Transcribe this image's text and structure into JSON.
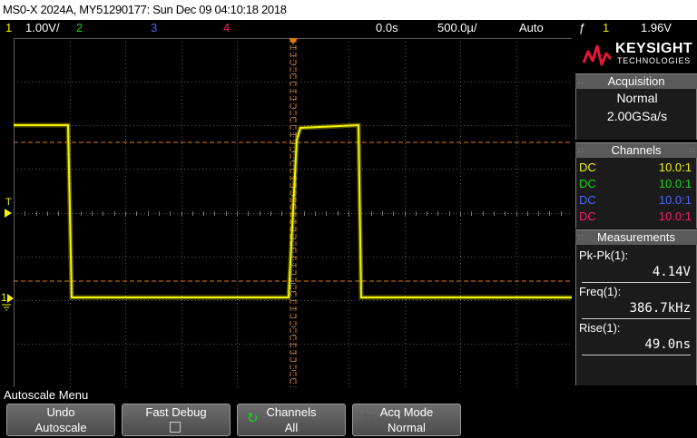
{
  "title_bar": {
    "text": "MS0-X 2024A, MY51290177: Sun Dec 09 04:10:18 2018"
  },
  "status_bar": {
    "ch1_num": "1",
    "ch1_scale": "1.00V/",
    "ch2_num": "2",
    "ch3_num": "3",
    "ch4_num": "4",
    "time_delay": "0.0s",
    "time_scale": "500.0µ/",
    "trigger_mode": "Auto",
    "trigger_slope_icon": "ƒ",
    "trigger_source": "1",
    "trigger_level": "1.96V"
  },
  "colors": {
    "ch1": "#f2f200",
    "ch2": "#19d219",
    "ch3": "#4a66ff",
    "ch4": "#ff1a6e",
    "cursor": "#e07a16",
    "grid": "#5a5a5a",
    "panel_header": "#5a5a5a"
  },
  "screen": {
    "trigger_marker": "T",
    "ground_marker": "1"
  },
  "panel": {
    "brand": "KEYSIGHT",
    "brand_sub": "TECHNOLOGIES",
    "acquisition": {
      "header": "Acquisition",
      "mode": "Normal",
      "rate": "2.00GSa/s"
    },
    "channels": {
      "header": "Channels",
      "rows": [
        {
          "coupling": "DC",
          "probe": "10.0:1"
        },
        {
          "coupling": "DC",
          "probe": "10.0:1"
        },
        {
          "coupling": "DC",
          "probe": "10.0:1"
        },
        {
          "coupling": "DC",
          "probe": "10.0:1"
        }
      ]
    },
    "measurements": {
      "header": "Measurements",
      "items": [
        {
          "label": "Pk-Pk(1):",
          "value": "4.14V"
        },
        {
          "label": "Freq(1):",
          "value": "386.7kHz"
        },
        {
          "label": "Rise(1):",
          "value": "49.0ns"
        }
      ]
    },
    "grip": "∷"
  },
  "menu": {
    "title": "Autoscale Menu",
    "softkeys": [
      {
        "l1": "Undo",
        "l2": "Autoscale"
      },
      {
        "l1": "Fast Debug",
        "l2": ""
      },
      {
        "l1": "Channels",
        "l2": "All",
        "icon": "↻"
      },
      {
        "l1": "Acq Mode",
        "l2": "Normal",
        "icon": "↻"
      }
    ]
  }
}
